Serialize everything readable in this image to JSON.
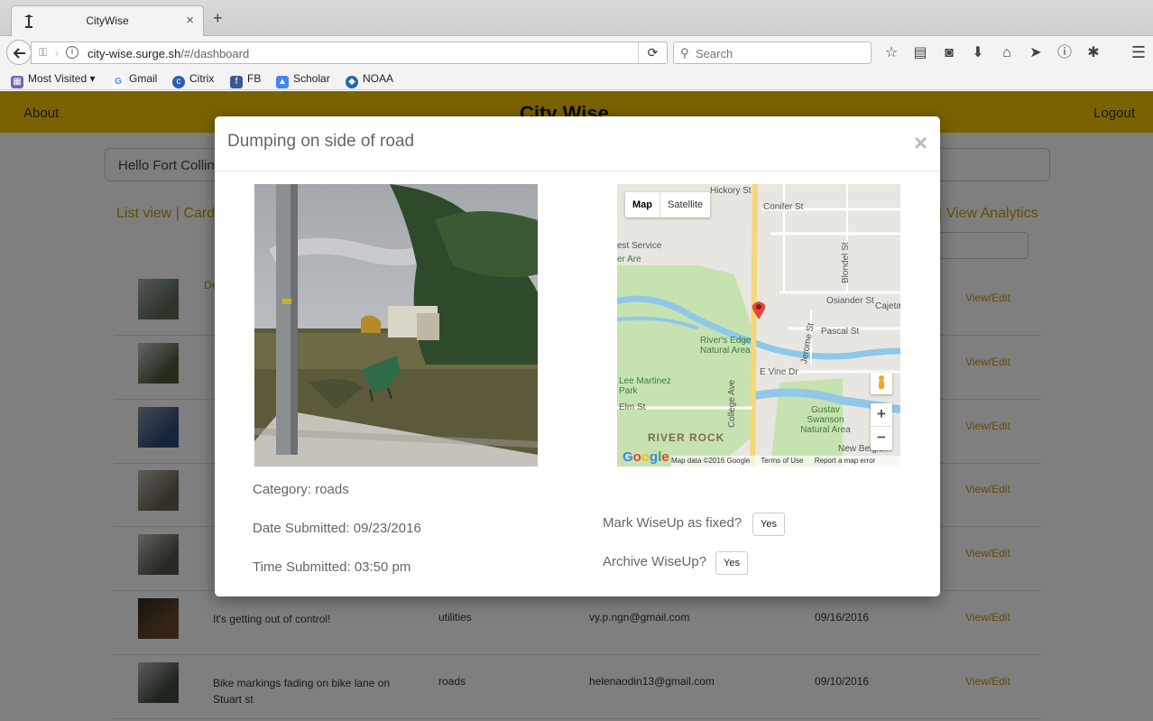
{
  "browser": {
    "tab_title": "CityWise",
    "url_host": "city-wise.surge.sh",
    "url_path": "/#/dashboard",
    "search_placeholder": "Search",
    "bookmarks": [
      "Most Visited",
      "Gmail",
      "Citrix",
      "FB",
      "Scholar",
      "NOAA"
    ]
  },
  "site": {
    "about": "About",
    "brand": "City Wise",
    "logout": "Logout",
    "hello": "Hello Fort Collin",
    "list_view": "List view",
    "card": "Card",
    "view_analytics": "View Analytics",
    "col_desc": "De",
    "view_edit": "View/Edit"
  },
  "rows": [
    {
      "desc": "",
      "category": "",
      "email": "",
      "date": ""
    },
    {
      "desc": "",
      "category": "",
      "email": "",
      "date": ""
    },
    {
      "desc": "",
      "category": "",
      "email": "",
      "date": ""
    },
    {
      "desc": "",
      "category": "",
      "email": "",
      "date": ""
    },
    {
      "desc": "",
      "category": "",
      "email": "",
      "date": ""
    },
    {
      "desc": "It's getting out of control!",
      "category": "utilities",
      "email": "vy.p.ngn@gmail.com",
      "date": "09/16/2016"
    },
    {
      "desc": "Bike markings fading on bike lane on Stuart st",
      "category": "roads",
      "email": "helenaodin13@gmail.com",
      "date": "09/10/2016"
    }
  ],
  "modal": {
    "title": "Dumping on side of road",
    "close": "×",
    "category": "Category: roads",
    "date_submitted": "Date Submitted: 09/23/2016",
    "time_submitted": "Time Submitted: 03:50 pm",
    "mark_fixed": "Mark WiseUp as fixed?",
    "archive": "Archive WiseUp?",
    "yes": "Yes"
  },
  "map": {
    "type_map": "Map",
    "type_satellite": "Satellite",
    "labels": [
      "Hickory St",
      "Conifer St",
      "est Service",
      "Osiander St",
      "Pascal St",
      "River's Edge Natural Area",
      "E Vine Dr",
      "Lee Martinez Park",
      "Elm St",
      "RIVER ROCK",
      "Gustav Swanson Natural Area",
      "New Belgium",
      "College Ave",
      "Jerome St",
      "Blondel St",
      "Cajeta",
      "er Area"
    ],
    "footer_data": "Map data ©2016 Google",
    "footer_terms": "Terms of Use",
    "footer_report": "Report a map error",
    "zoom_in": "+",
    "zoom_out": "−"
  }
}
